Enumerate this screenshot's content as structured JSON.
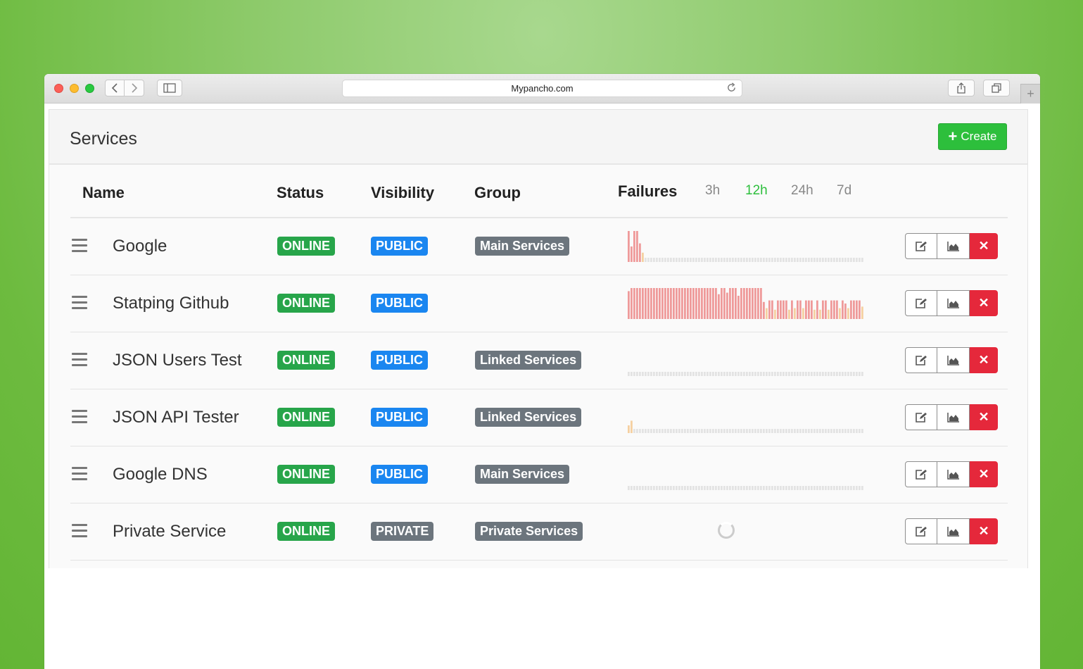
{
  "browser": {
    "url": "Mypancho.com",
    "icons": [
      "chevron-left-icon",
      "chevron-right-icon",
      "sidebar-icon",
      "reload-icon",
      "share-icon",
      "tabs-icon",
      "plus-icon"
    ]
  },
  "page": {
    "title": "Services",
    "create_label": "Create"
  },
  "table": {
    "headers": {
      "name": "Name",
      "status": "Status",
      "visibility": "Visibility",
      "group": "Group",
      "failures": "Failures"
    },
    "ranges": [
      "3h",
      "12h",
      "24h",
      "7d"
    ],
    "active_range": "12h",
    "rows": [
      {
        "name": "Google",
        "status": "ONLINE",
        "visibility": "PUBLIC",
        "group": "Main Services",
        "failures": [
          1,
          0.5,
          1,
          1,
          0.6,
          0.3,
          0,
          0,
          0,
          0,
          0,
          0,
          0,
          0,
          0,
          0,
          0,
          0,
          0,
          0,
          0,
          0,
          0,
          0,
          0,
          0,
          0,
          0,
          0,
          0,
          0,
          0,
          0,
          0,
          0,
          0,
          0,
          0,
          0,
          0,
          0,
          0,
          0,
          0,
          0,
          0,
          0,
          0,
          0,
          0,
          0,
          0,
          0,
          0,
          0,
          0,
          0,
          0,
          0,
          0,
          0,
          0,
          0,
          0,
          0,
          0,
          0,
          0,
          0,
          0,
          0,
          0,
          0,
          0,
          0,
          0,
          0,
          0,
          0,
          0,
          0,
          0,
          0,
          0
        ]
      },
      {
        "name": "Statping Github",
        "status": "ONLINE",
        "visibility": "PUBLIC",
        "group": "",
        "failures": [
          0.9,
          1,
          1,
          1,
          1,
          1,
          1,
          1,
          1,
          1,
          1,
          1,
          1,
          1,
          1,
          1,
          1,
          1,
          1,
          1,
          1,
          1,
          1,
          1,
          1,
          1,
          1,
          1,
          1,
          1,
          1,
          1,
          0.8,
          1,
          1,
          0.85,
          1,
          1,
          1,
          0.75,
          1,
          1,
          1,
          1,
          1,
          1,
          1,
          1,
          0.55,
          0.35,
          0.6,
          0.6,
          0.3,
          0.6,
          0.6,
          0.6,
          0.6,
          0.3,
          0.6,
          0.35,
          0.6,
          0.6,
          0.35,
          0.6,
          0.6,
          0.6,
          0.3,
          0.6,
          0.3,
          0.6,
          0.6,
          0.3,
          0.6,
          0.6,
          0.6,
          0.35,
          0.6,
          0.5,
          0.35,
          0.6,
          0.6,
          0.6,
          0.6,
          0.4
        ]
      },
      {
        "name": "JSON Users Test",
        "status": "ONLINE",
        "visibility": "PUBLIC",
        "group": "Linked Services",
        "failures": [
          0,
          0,
          0,
          0,
          0,
          0,
          0,
          0,
          0,
          0,
          0,
          0,
          0,
          0,
          0,
          0,
          0,
          0,
          0,
          0,
          0,
          0,
          0,
          0,
          0,
          0,
          0,
          0,
          0,
          0,
          0,
          0,
          0,
          0,
          0,
          0,
          0,
          0,
          0,
          0,
          0,
          0,
          0,
          0,
          0,
          0,
          0,
          0,
          0,
          0,
          0,
          0,
          0,
          0,
          0,
          0,
          0,
          0,
          0,
          0,
          0,
          0,
          0,
          0,
          0,
          0,
          0,
          0,
          0,
          0,
          0,
          0,
          0,
          0,
          0,
          0,
          0,
          0,
          0,
          0,
          0,
          0,
          0,
          0
        ]
      },
      {
        "name": "JSON API Tester",
        "status": "ONLINE",
        "visibility": "PUBLIC",
        "group": "Linked Services",
        "failures": [
          0.25,
          0.4,
          0,
          0,
          0,
          0,
          0,
          0,
          0,
          0,
          0,
          0,
          0,
          0,
          0,
          0,
          0,
          0,
          0,
          0,
          0,
          0,
          0,
          0,
          0,
          0,
          0,
          0,
          0,
          0,
          0,
          0,
          0,
          0,
          0,
          0,
          0,
          0,
          0,
          0,
          0,
          0,
          0,
          0,
          0,
          0,
          0,
          0,
          0,
          0,
          0,
          0,
          0,
          0,
          0,
          0,
          0,
          0,
          0,
          0,
          0,
          0,
          0,
          0,
          0,
          0,
          0,
          0,
          0,
          0,
          0,
          0,
          0,
          0,
          0,
          0,
          0,
          0,
          0,
          0,
          0,
          0,
          0,
          0
        ]
      },
      {
        "name": "Google DNS",
        "status": "ONLINE",
        "visibility": "PUBLIC",
        "group": "Main Services",
        "failures": [
          0,
          0,
          0,
          0,
          0,
          0,
          0,
          0,
          0,
          0,
          0,
          0,
          0,
          0,
          0,
          0,
          0,
          0,
          0,
          0,
          0,
          0,
          0,
          0,
          0,
          0,
          0,
          0,
          0,
          0,
          0,
          0,
          0,
          0,
          0,
          0,
          0,
          0,
          0,
          0,
          0,
          0,
          0,
          0,
          0,
          0,
          0,
          0,
          0,
          0,
          0,
          0,
          0,
          0,
          0,
          0,
          0,
          0,
          0,
          0,
          0,
          0,
          0,
          0,
          0,
          0,
          0,
          0,
          0,
          0,
          0,
          0,
          0,
          0,
          0,
          0,
          0,
          0,
          0,
          0,
          0,
          0,
          0,
          0
        ]
      },
      {
        "name": "Private Service",
        "status": "ONLINE",
        "visibility": "PRIVATE",
        "group": "Private Services",
        "failures": null
      }
    ]
  },
  "colors": {
    "online": "#27a54a",
    "public": "#1a86f0",
    "private": "#6c757d",
    "fail_high": "#ef9a9a",
    "fail_low": "#f5d0a0",
    "fail_none": "#e3e3e3",
    "create": "#2dbf3c",
    "delete": "#e5283b"
  }
}
